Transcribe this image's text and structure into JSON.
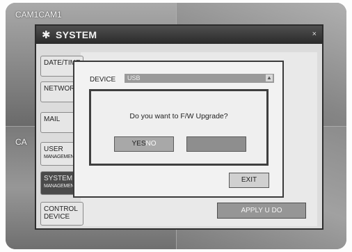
{
  "cameras": {
    "top_left_label": "CAM1CAM1",
    "mid_left_label": "CA"
  },
  "window": {
    "title": "SYSTEM",
    "close_glyph": "×"
  },
  "sidebar": {
    "items": [
      {
        "label": "DATE/TIME",
        "sub": ""
      },
      {
        "label": "NETWORK",
        "sub": ""
      },
      {
        "label": "MAIL",
        "sub": ""
      },
      {
        "label": "USER",
        "sub": "MANAGEMENT"
      },
      {
        "label": "SYSTEM",
        "sub": "MANAGEMENT"
      },
      {
        "label": "CONTROL",
        "sub": "DEVICE"
      }
    ]
  },
  "device_panel": {
    "label": "DEVICE",
    "selected_value": "USB",
    "exit_label": "EXIT"
  },
  "dialog": {
    "message": "Do you want to F/W Upgrade?",
    "yes_label": "YES",
    "no_label": "NO"
  },
  "footer": {
    "apply_label": "APPLY U  DO"
  },
  "colors": {
    "title_bar": "#2a2a2a",
    "window_bg": "#dcdcdc",
    "button_bg": "#969696"
  }
}
